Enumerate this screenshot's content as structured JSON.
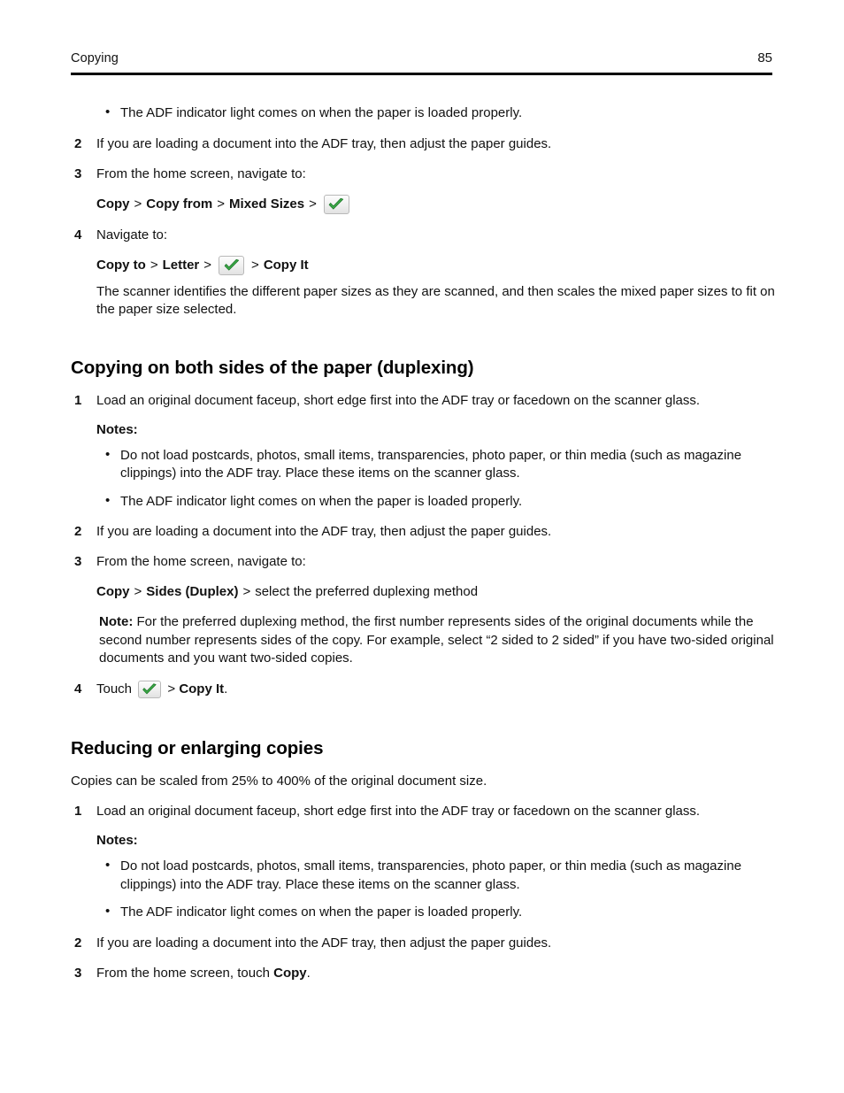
{
  "header": {
    "title": "Copying",
    "page_number": "85"
  },
  "icons": {
    "check": "green-check-icon",
    "check_color": "#3fae4a",
    "check_outline": "#1f7a2b",
    "button_bg": "#f0f0f0",
    "button_border": "#b9b9b9"
  },
  "continued_section": {
    "orphan_bullets": [
      "The ADF indicator light comes on when the paper is loaded properly."
    ],
    "steps": [
      {
        "num": "2",
        "text": "If you are loading a document into the ADF tray, then adjust the paper guides."
      },
      {
        "num": "3",
        "text": "From the home screen, navigate to:",
        "navline": {
          "item1": "Copy",
          "sep1": ">",
          "item2": "Copy from",
          "sep2": ">",
          "item3": "Mixed Sizes",
          "sep3": ">"
        }
      },
      {
        "num": "4",
        "text": "Navigate to:",
        "navline": {
          "item1": "Copy to",
          "sep1": ">",
          "item2": "Letter",
          "sep2": ">",
          "sep3": ">",
          "item4": "Copy It"
        },
        "follow_para": "The scanner identifies the different paper sizes as they are scanned, and then scales the mixed paper sizes to fit on the paper size selected."
      }
    ]
  },
  "section_duplexing": {
    "heading": "Copying on both sides of the paper (duplexing)",
    "step1": {
      "num": "1",
      "text": "Load an original document faceup, short edge first into the ADF tray or facedown on the scanner glass.",
      "notes_label": "Notes:",
      "bullets": [
        "Do not load postcards, photos, small items, transparencies, photo paper, or thin media (such as magazine clippings) into the ADF tray. Place these items on the scanner glass.",
        "The ADF indicator light comes on when the paper is loaded properly."
      ]
    },
    "step2": {
      "num": "2",
      "text": "If you are loading a document into the ADF tray, then adjust the paper guides."
    },
    "step3": {
      "num": "3",
      "text": "From the home screen, navigate to:",
      "navline": {
        "item1": "Copy",
        "sep1": ">",
        "item2": "Sides (Duplex)",
        "sep2": ">",
        "item3": "select the preferred duplexing method"
      },
      "note_label": "Note:",
      "note_text": "For the preferred duplexing method, the first number represents sides of the original documents while the second number represents sides of the copy. For example, select “2 sided to 2 sided” if you have two-sided original documents and you want two-sided copies."
    },
    "step4": {
      "num": "4",
      "prefix": "Touch",
      "sep": ">",
      "target": "Copy It",
      "suffix": "."
    }
  },
  "section_reducing": {
    "heading": "Reducing or enlarging copies",
    "intro": "Copies can be scaled from 25% to 400% of the original document size.",
    "step1": {
      "num": "1",
      "text": "Load an original document faceup, short edge first into the ADF tray or facedown on the scanner glass.",
      "notes_label": "Notes:",
      "bullets": [
        "Do not load postcards, photos, small items, transparencies, photo paper, or thin media (such as magazine clippings) into the ADF tray. Place these items on the scanner glass.",
        "The ADF indicator light comes on when the paper is loaded properly."
      ]
    },
    "step2": {
      "num": "2",
      "text": "If you are loading a document into the ADF tray, then adjust the paper guides."
    },
    "step3": {
      "num": "3",
      "prefix": "From the home screen, touch",
      "target": "Copy",
      "suffix": "."
    }
  }
}
